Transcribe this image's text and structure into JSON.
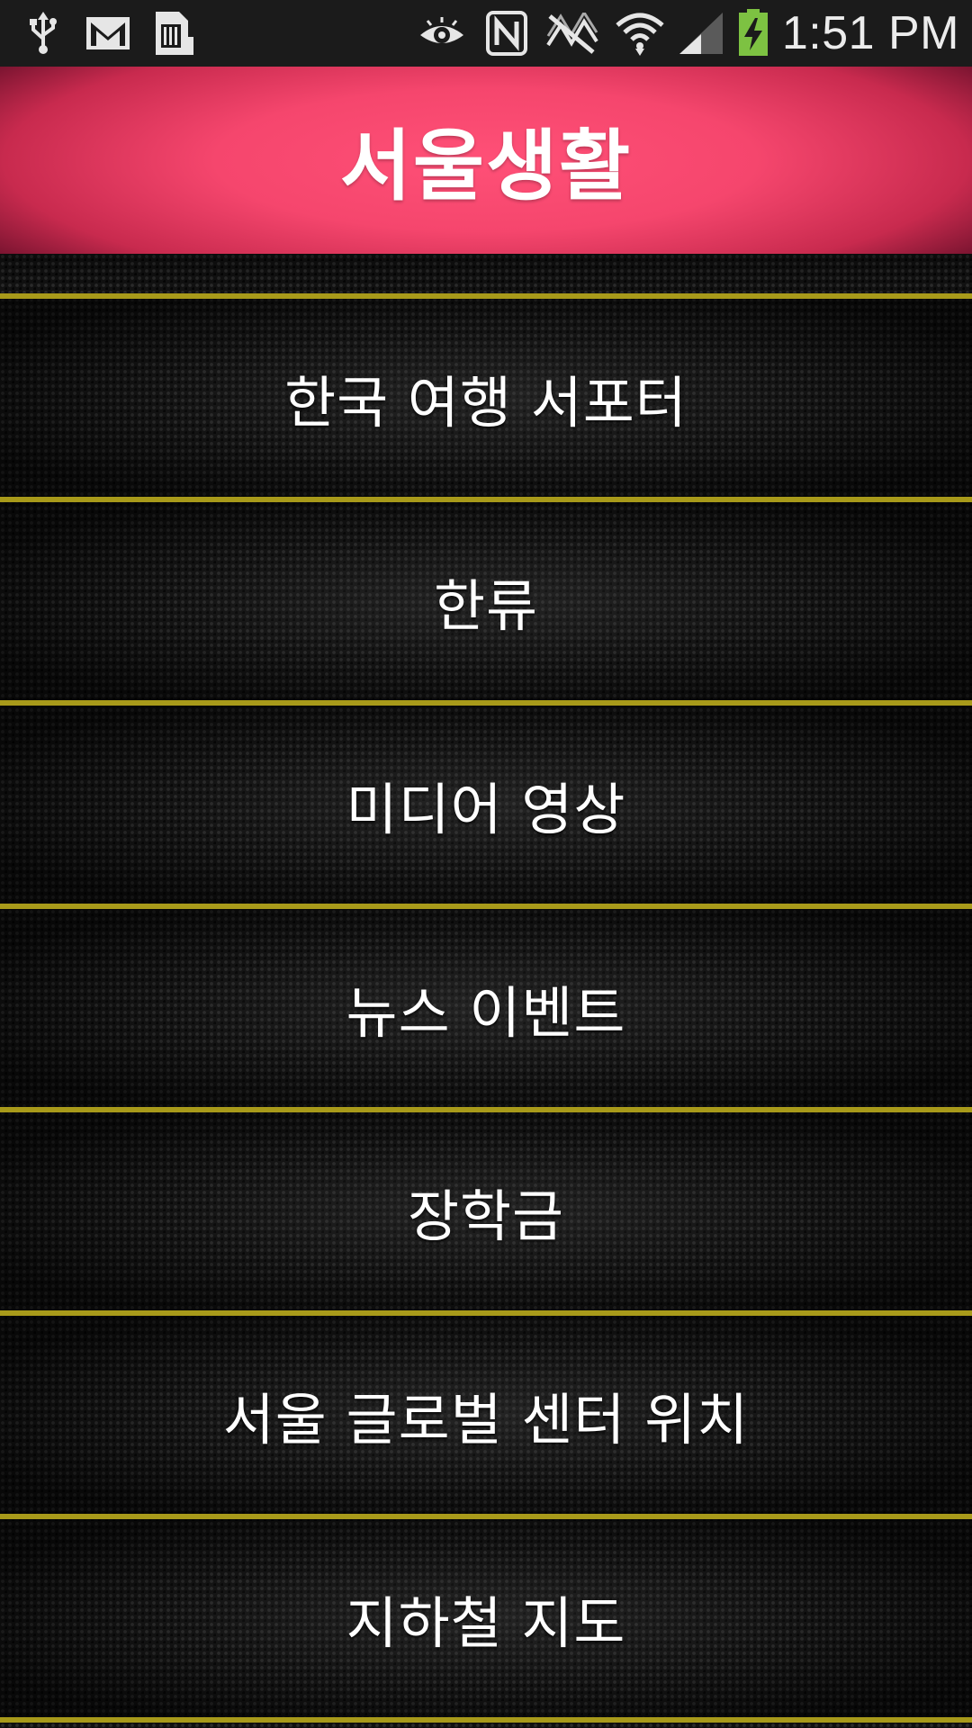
{
  "status_bar": {
    "time": "1:51 PM",
    "icons": [
      "usb-icon",
      "gmail-icon",
      "sd-card-icon",
      "eye-icon",
      "nfc-icon",
      "muted-signal-icon",
      "wifi-icon",
      "cell-signal-icon",
      "battery-charging-icon"
    ],
    "battery_color": "#7dc242"
  },
  "header": {
    "title": "서울생활",
    "color": "#ff4f77"
  },
  "menu": {
    "divider_color": "#a89a1a",
    "items": [
      {
        "label": "한국 여행 서포터"
      },
      {
        "label": "한류"
      },
      {
        "label": "미디어 영상"
      },
      {
        "label": "뉴스 이벤트"
      },
      {
        "label": "장학금"
      },
      {
        "label": "서울 글로벌 센터 위치"
      },
      {
        "label": "지하철 지도"
      }
    ]
  }
}
